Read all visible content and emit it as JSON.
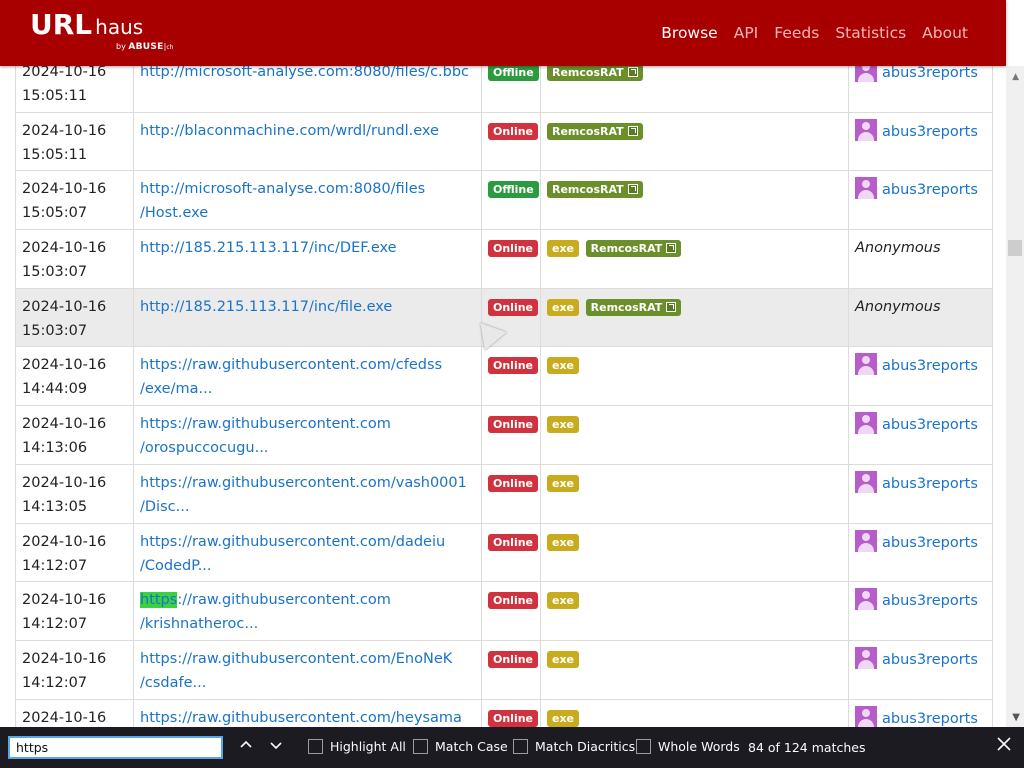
{
  "header": {
    "logo_main": "URL",
    "logo_sub": "haus",
    "logo_by": "by",
    "logo_org": "ABUSE",
    "logo_mark": "ch",
    "nav": [
      {
        "label": "Browse"
      },
      {
        "label": "API"
      },
      {
        "label": "Feeds"
      },
      {
        "label": "Statistics"
      },
      {
        "label": "About"
      }
    ],
    "header_color": "#a80000"
  },
  "rows": [
    {
      "date": "2024-10-16",
      "time": "15:05:11",
      "url1": "http://microsoft-analyse.com:8080/files/c.bbc",
      "url2": "",
      "status": "Offline",
      "tags": [
        "RemcosRAT"
      ],
      "reporter": "abus3reports"
    },
    {
      "date": "2024-10-16",
      "time": "15:05:11",
      "url1": "http://blaconmachine.com/wrdl/rundl.exe",
      "url2": "",
      "status": "Online",
      "tags": [
        "RemcosRAT"
      ],
      "reporter": "abus3reports"
    },
    {
      "date": "2024-10-16",
      "time": "15:05:07",
      "url1": "http://microsoft-analyse.com:8080/files",
      "url2": "/Host.exe",
      "status": "Offline",
      "tags": [
        "RemcosRAT"
      ],
      "reporter": "abus3reports"
    },
    {
      "date": "2024-10-16",
      "time": "15:03:07",
      "url1": "http://185.215.113.117/inc/DEF.exe",
      "url2": "",
      "status": "Online",
      "tags": [
        "exe",
        "RemcosRAT"
      ],
      "reporter": "Anonymous"
    },
    {
      "date": "2024-10-16",
      "time": "15:03:07",
      "url1": "http://185.215.113.117/inc/file.exe",
      "url2": "",
      "status": "Online",
      "tags": [
        "exe",
        "RemcosRAT"
      ],
      "reporter": "Anonymous"
    },
    {
      "date": "2024-10-16",
      "time": "14:44:09",
      "url1": "https://raw.githubusercontent.com/cfedss",
      "url2": "/exe/ma...",
      "status": "Online",
      "tags": [
        "exe"
      ],
      "reporter": "abus3reports"
    },
    {
      "date": "2024-10-16",
      "time": "14:13:06",
      "url1": "https://raw.githubusercontent.com",
      "url2": "/orospuccocugu...",
      "status": "Online",
      "tags": [
        "exe"
      ],
      "reporter": "abus3reports"
    },
    {
      "date": "2024-10-16",
      "time": "14:13:05",
      "url1": "https://raw.githubusercontent.com/vash0001",
      "url2": "/Disc...",
      "status": "Online",
      "tags": [
        "exe"
      ],
      "reporter": "abus3reports"
    },
    {
      "date": "2024-10-16",
      "time": "14:12:07",
      "url1": "https://raw.githubusercontent.com/dadeiu",
      "url2": "/CodedP...",
      "status": "Online",
      "tags": [
        "exe"
      ],
      "reporter": "abus3reports"
    },
    {
      "date": "2024-10-16",
      "time": "14:12:07",
      "url1_match": "https",
      "url1": "://raw.githubusercontent.com",
      "url2": "/krishnatheroc...",
      "status": "Online",
      "tags": [
        "exe"
      ],
      "reporter": "abus3reports"
    },
    {
      "date": "2024-10-16",
      "time": "14:12:07",
      "url1": "https://raw.githubusercontent.com/EnoNeK",
      "url2": "/csdafe...",
      "status": "Online",
      "tags": [
        "exe"
      ],
      "reporter": "abus3reports"
    },
    {
      "date": "2024-10-16",
      "time": "",
      "url1": "https://raw.githubusercontent.com/heysama",
      "url2": "",
      "status": "Online",
      "tags": [
        "exe"
      ],
      "reporter": "abus3reports"
    }
  ],
  "findbar": {
    "query": "https",
    "prev_icon": "chevron-up-icon",
    "next_icon": "chevron-down-icon",
    "highlight_all": "Highlight All",
    "match_case": "Match Case",
    "match_diacritics": "Match Diacritics",
    "whole_words": "Whole Words",
    "match_count": "84 of 124 matches",
    "close_icon": "close-icon"
  },
  "colors": {
    "online": "#d0333f",
    "offline": "#2c9b3f",
    "exe": "#c8ac1e",
    "remcos": "#6b8f2a",
    "link": "#1a73c8",
    "match_highlight": "#3ad142"
  }
}
